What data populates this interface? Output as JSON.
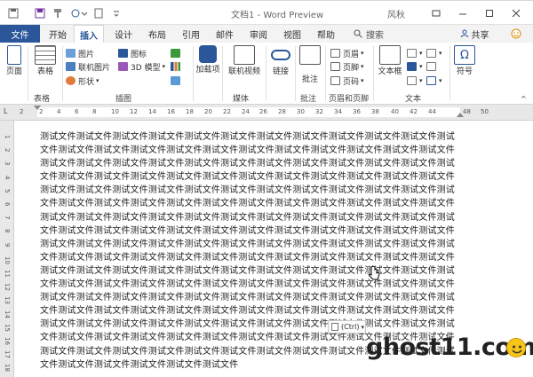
{
  "window": {
    "title": "文档1 - Word Preview",
    "user": "风秋"
  },
  "tabs": [
    "文件",
    "开始",
    "插入",
    "设计",
    "布局",
    "引用",
    "邮件",
    "审阅",
    "视图",
    "帮助"
  ],
  "search_label": "搜索",
  "share_label": "共享",
  "ribbon": {
    "pages": {
      "button": "页面"
    },
    "table": {
      "button": "表格",
      "group": "表格"
    },
    "illustrations": {
      "picture": "图片",
      "online_picture": "联机图片",
      "shapes": "形状",
      "icons": "图标",
      "model": "3D 模型",
      "group": "插图"
    },
    "addins": {
      "button": "加载项"
    },
    "media": {
      "button": "联机视频",
      "group": "媒体"
    },
    "links": {
      "button": "链接"
    },
    "comments": {
      "button": "批注",
      "group": "批注"
    },
    "header_footer": {
      "header": "页眉",
      "footer": "页脚",
      "page_number": "页码",
      "group": "页眉和页脚"
    },
    "text": {
      "textbox": "文本框",
      "group": "文本"
    },
    "symbols": {
      "button": "符号"
    }
  },
  "ruler_marks": [
    "2",
    "2",
    "4",
    "6",
    "8",
    "10",
    "12",
    "14",
    "16",
    "18",
    "20",
    "22",
    "24",
    "26",
    "28",
    "30",
    "32",
    "34",
    "36",
    "38",
    "40",
    "42",
    "44",
    "48",
    "50"
  ],
  "vruler_marks": [
    "1",
    "2",
    "3",
    "4",
    "5",
    "6",
    "7",
    "8",
    "9",
    "10",
    "11",
    "12",
    "13",
    "14",
    "15",
    "16",
    "17",
    "18"
  ],
  "document": {
    "text": "测试文件测试文件测试文件测试文件测试文件测试文件测试文件测试文件测试文件测试文件测试文件测试文件测试文件测试文件测试文件测试文件测试文件测试文件测试文件测试文件测试文件测试文件测试文件测试文件测试文件测试文件测试文件测试文件测试文件测试文件测试文件测试文件测试文件测试文件测试文件测试文件测试文件测试文件测试文件测试文件测试文件测试文件测试文件测试文件测试文件测试文件测试文件测试文件测试文件测试文件测试文件测试文件测试文件测试文件测试文件测试文件测试文件测试文件测试文件测试文件测试文件测试文件测试文件测试文件测试文件测试文件测试文件测试文件测试文件测试文件测试文件测试文件测试文件测试文件测试文件测试文件测试文件测试文件测试文件测试文件测试文件测试文件测试文件测试文件测试文件测试文件测试文件测试文件测试文件测试文件测试文件测试文件测试文件测试文件测试文件测试文件测试文件测试文件测试文件测试文件测试文件测试文件测试文件测试文件测试文件测试文件测试文件测试文件测试文件测试文件测试文件测试文件测试文件测试文件测试文件测试文件测试文件测试文件测试文件测试文件测试文件测试文件测试文件测试文件测试文件测试文件测试文件测试文件测试文件测试文件测试文件测试文件测试文件测试文件测试文件测试文件测试文件测试文件测试文件测试文件测试文件测试文件测试文件测试文件测试文件测试文件测试文件测试文件测试文件测试文件测试文件测试文件测试文件测试文件测试文件测试文件测试文件测试文件测试文件测试文件测试文件测试文件测试文件测试文件测试文件测试文件测试文件测试文件测试文件测试文件测试文件测试文件测试文件测试文件测试文件测试文件测试文件测试文件测试文件测试文件测试文件测试文件测试文件测试文件测试文件测试文件测试文件测试文件测试文件测试文件测试文件测试文件测试文件测试文件测试文件测试文件测试文件测试文件测试文件测试文件测试文件"
  },
  "paste_options": "(Ctrl)",
  "watermark": "ghost11.com",
  "colors": {
    "accent": "#2b579a",
    "title_bar_border": "#e0e0e0"
  }
}
